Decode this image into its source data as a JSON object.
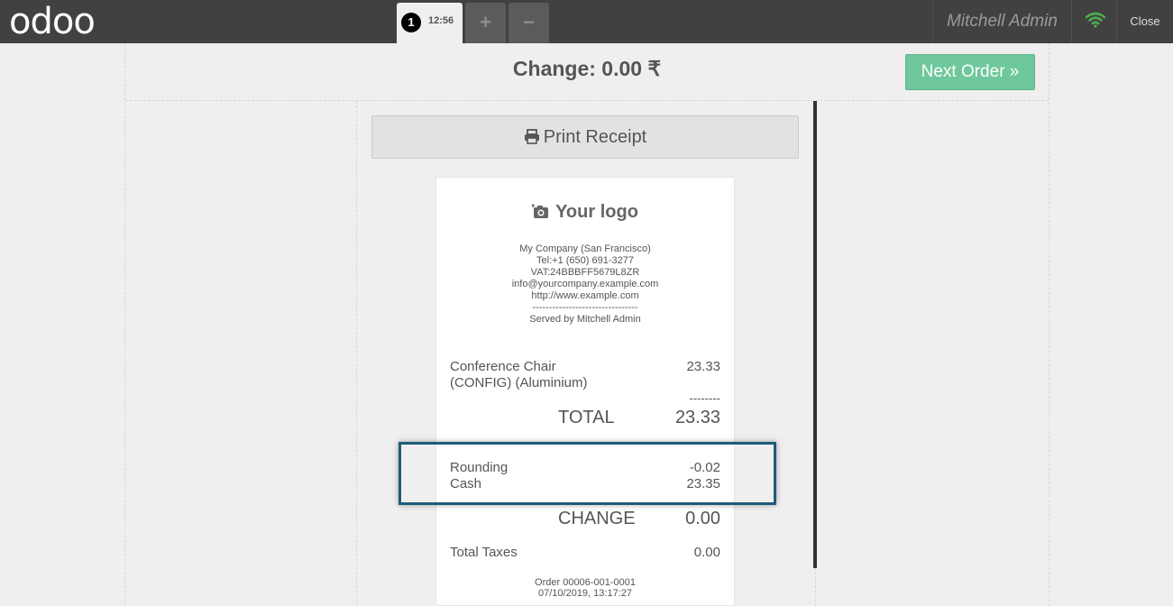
{
  "topbar": {
    "logo": "odoo",
    "order_number": "1",
    "order_time": "12:56",
    "add_label": "+",
    "remove_label": "−",
    "user": "Mitchell Admin",
    "close_label": "Close"
  },
  "header": {
    "change": "Change: 0.00 ₹",
    "next_order": "Next Order »"
  },
  "print_button": "Print Receipt",
  "receipt": {
    "logo_text": "Your logo",
    "company_lines": [
      "My Company (San Francisco)",
      "Tel:+1 (650) 691-3277",
      "VAT:24BBBFF5679L8ZR",
      "info@yourcompany.example.com",
      "http://www.example.com",
      "--------------------------------",
      "Served by Mitchell Admin"
    ],
    "line_item": {
      "name_1": "Conference Chair",
      "name_2": "(CONFIG) (Aluminium)",
      "price": "23.33"
    },
    "separator": "--------",
    "total_label": "TOTAL",
    "total_value": "23.33",
    "rounding_label": "Rounding",
    "rounding_value": "-0.02",
    "cash_label": "Cash",
    "cash_value": "23.35",
    "change_label": "CHANGE",
    "change_value": "0.00",
    "taxes_label": "Total Taxes",
    "taxes_value": "0.00",
    "order_ref": "Order 00006-001-0001",
    "order_date": "07/10/2019, 13:17:27"
  },
  "colors": {
    "topbar": "#414141",
    "accent_green": "#6ec89b",
    "wifi": "#4caf50",
    "highlight": "#1d5c77"
  }
}
